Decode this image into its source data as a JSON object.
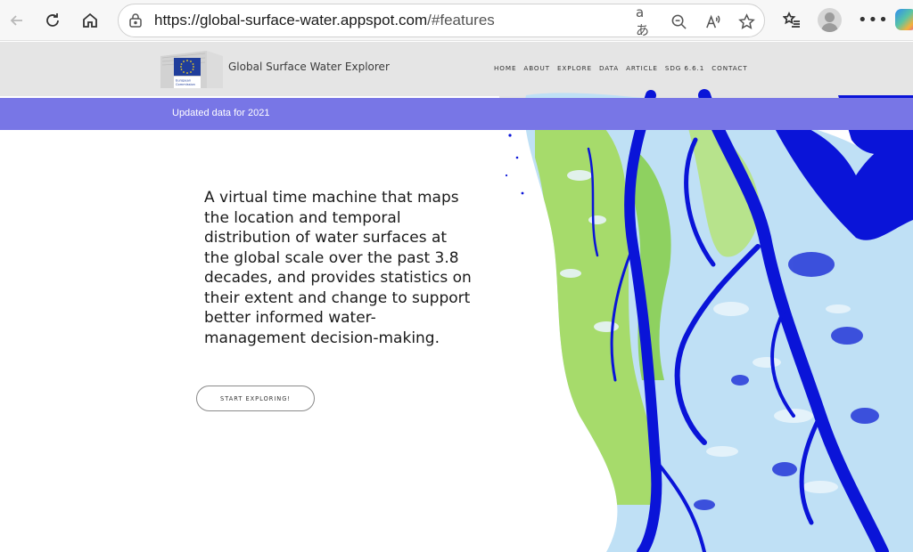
{
  "browser": {
    "url_host": "https://global-surface-water.appspot.com",
    "url_path": "/#features",
    "read_aloud_label": "aあ"
  },
  "site": {
    "title": "Global Surface Water Explorer",
    "logo_label": "European Commission",
    "menu": [
      "HOME",
      "ABOUT",
      "EXPLORE",
      "DATA",
      "ARTICLE",
      "SDG 6.6.1",
      "CONTACT"
    ]
  },
  "banner": {
    "text": "Updated data for 2021"
  },
  "hero": {
    "description": "A virtual time machine that maps the location and temporal distribution of water surfaces at the global scale over the past 3.8 decades, and provides statistics on their extent and change to support better informed water-management decision-making.",
    "cta_label": "START EXPLORING!"
  },
  "colors": {
    "banner": "#7876e6",
    "header": "#e5e5e5",
    "water_permanent": "#0a14d8",
    "water_seasonal": "#8ec3ea",
    "land_green": "#8fd44a"
  }
}
